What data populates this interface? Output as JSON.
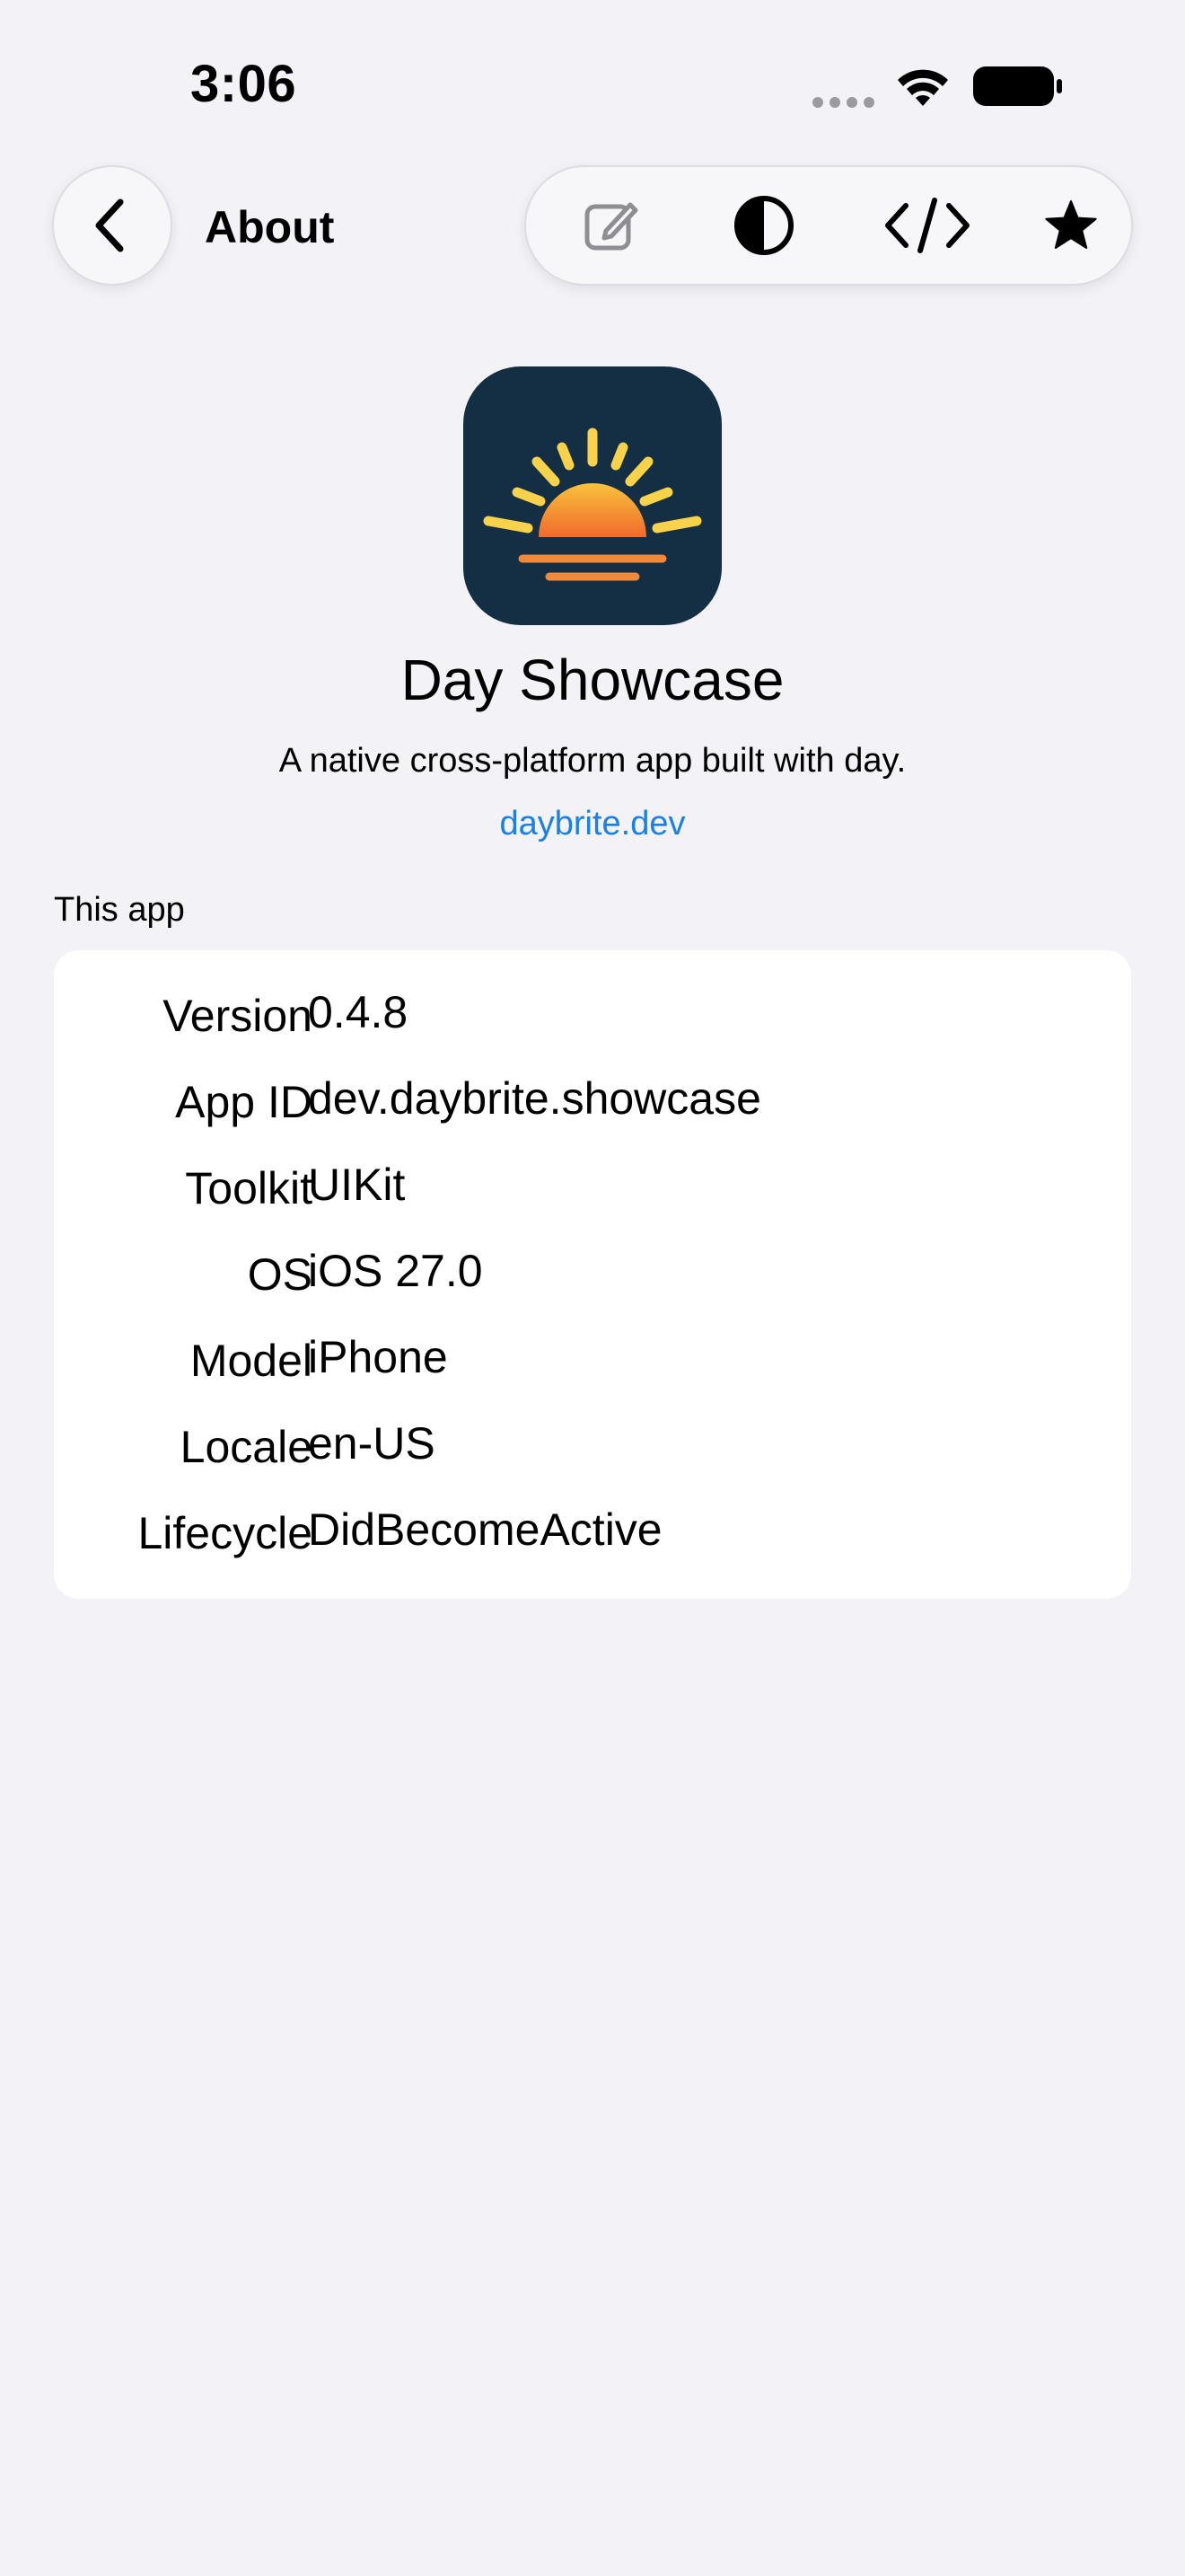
{
  "status_bar": {
    "time": "3:06",
    "icons": [
      "signal-dots-icon",
      "wifi-icon",
      "battery-icon"
    ]
  },
  "nav": {
    "back_icon": "chevron-left-icon",
    "title": "About",
    "toolbar": [
      {
        "name": "edit",
        "icon": "compose-icon",
        "enabled": false
      },
      {
        "name": "appearance",
        "icon": "contrast-icon"
      },
      {
        "name": "source",
        "icon": "code-icon"
      },
      {
        "name": "favorite",
        "icon": "star-icon"
      }
    ]
  },
  "app": {
    "icon": "sunrise-logo",
    "name": "Day Showcase",
    "description": "A native cross-platform app built with day.",
    "link": "daybrite.dev"
  },
  "section": {
    "header": "This app",
    "rows": [
      {
        "label": "Version",
        "value": "0.4.8"
      },
      {
        "label": "App ID",
        "value": "dev.daybrite.showcase"
      },
      {
        "label": "Toolkit",
        "value": "UIKit"
      },
      {
        "label": "OS",
        "value": "iOS 27.0"
      },
      {
        "label": "Model",
        "value": "iPhone"
      },
      {
        "label": "Locale",
        "value": "en-US"
      },
      {
        "label": "Lifecycle",
        "value": "DidBecomeActive"
      }
    ]
  },
  "colors": {
    "background": "#f2f2f7",
    "card": "#ffffff",
    "link": "#1a80e6",
    "icon_bg": "#142f44",
    "sun_yellow": "#f7d24a",
    "sun_orange": "#f07a2e"
  }
}
